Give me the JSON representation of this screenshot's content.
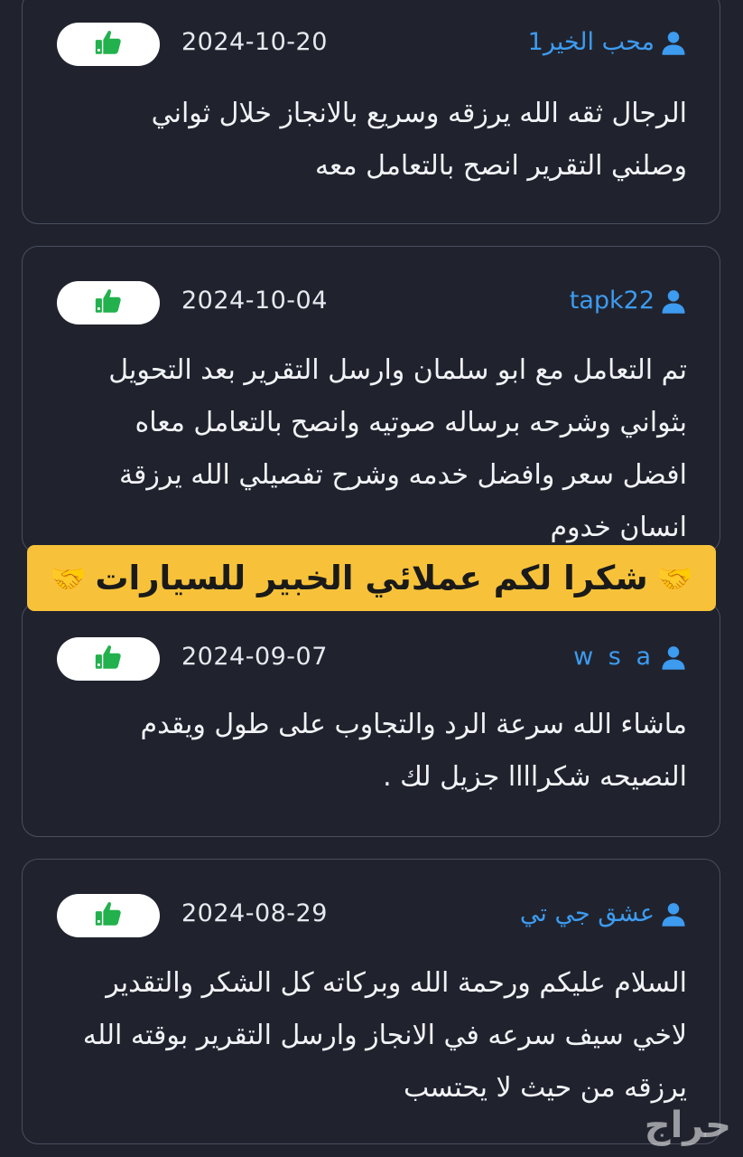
{
  "reviews": [
    {
      "author": "محب الخير1",
      "date": "2024-10-20",
      "text": "الرجال ثقه الله يرزقه وسريع بالانجاز خلال ثواني وصلني التقرير انصح بالتعامل معه"
    },
    {
      "author": "tapk22",
      "date": "2024-10-04",
      "text": "تم التعامل مع ابو سلمان وارسل التقرير بعد التحويل بثواني وشرحه برساله صوتيه وانصح بالتعامل معاه افضل سعر وافضل خدمه وشرح تفصيلي الله يرزقة انسان خدوم"
    },
    {
      "author": "w s a",
      "date": "2024-09-07",
      "text": "ماشاء الله سرعة الرد والتجاوب على طول ويقدم النصيحه شكراااا جزيل لك ."
    },
    {
      "author": "عشق جي تي",
      "date": "2024-08-29",
      "text": "السلام عليكم ورحمة الله وبركاته كل الشكر والتقدير لاخي سيف سرعه في الانجاز وارسل التقرير بوقته الله يرزقه من حيث لا يحتسب"
    }
  ],
  "banner": {
    "text": "شكرا لكم عملائي الخبير للسيارات",
    "icon": "handshake-icon"
  },
  "watermark": {
    "text": "حراج"
  },
  "icons": {
    "like": "thumbs-up-icon",
    "user": "user-icon"
  },
  "colors": {
    "background": "#20232e",
    "author_link": "#3d9bf0",
    "like_green": "#22b14c",
    "banner": "#f7c23a"
  }
}
